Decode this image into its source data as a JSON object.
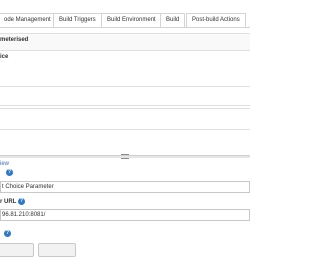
{
  "tabs": [
    "ode Management",
    "Build Triggers",
    "Build Environment",
    "Build",
    "Post-build Actions"
  ],
  "param": {
    "heading": "meterised",
    "subheading": "ice"
  },
  "view_link": "iew",
  "choice_type_value": "t Choice Parameter",
  "url_label": "r URL",
  "url_value": "96.81.210:8081/"
}
